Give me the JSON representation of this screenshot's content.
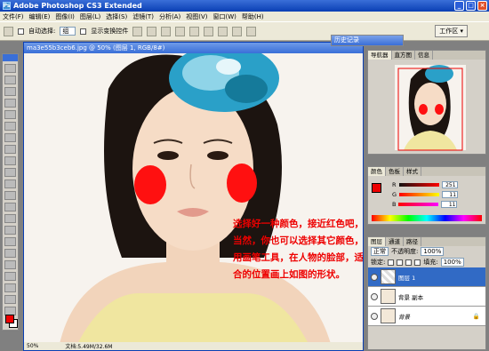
{
  "window": {
    "title": "Adobe Photoshop CS3 Extended",
    "badge": "Ps"
  },
  "menu": [
    "文件(F)",
    "编辑(E)",
    "图像(I)",
    "图层(L)",
    "选择(S)",
    "滤镜(T)",
    "分析(A)",
    "视图(V)",
    "窗口(W)",
    "帮助(H)"
  ],
  "options": {
    "auto_select_label": "自动选择:",
    "auto_select_value": "组",
    "show_transform_label": "显示变换控件",
    "workspace_label": "工作区 ▾"
  },
  "document": {
    "title": "ma3e55b3ceb6.jpg @ 50% (图层 1, RGB/8#)",
    "zoom": "50%",
    "doc_info": "文档:5.49M/32.6M",
    "caption": "选择好一种颜色，接近红色吧，当然，你也可以选择其它颜色，用画笔工具，在人物的脸部，适合的位置画上如图的形状。"
  },
  "history_panel": {
    "title": "历史记录"
  },
  "navigator_panel": {
    "tabs": [
      "导航器",
      "直方图",
      "信息"
    ]
  },
  "color_panel": {
    "tabs": [
      "颜色",
      "色板",
      "样式"
    ],
    "channels": [
      {
        "label": "R",
        "value": "251",
        "color": "#e00000"
      },
      {
        "label": "G",
        "value": "11",
        "color": "#00a000"
      },
      {
        "label": "B",
        "value": "11",
        "color": "#0000e0"
      }
    ]
  },
  "layers_panel": {
    "tabs": [
      "图层",
      "通道",
      "路径"
    ],
    "blend_mode": "正常",
    "opacity_label": "不透明度:",
    "opacity_value": "100%",
    "lock_label": "锁定:",
    "fill_label": "填充:",
    "fill_value": "100%",
    "layers": [
      {
        "name": "图层 1",
        "selected": true
      },
      {
        "name": "背景 副本",
        "selected": false
      },
      {
        "name": "背景",
        "selected": false
      }
    ]
  },
  "colors": {
    "foreground": "#ee0000",
    "background": "#ffffff",
    "accent": "#3a6fd8",
    "caption": "#ee0000"
  }
}
